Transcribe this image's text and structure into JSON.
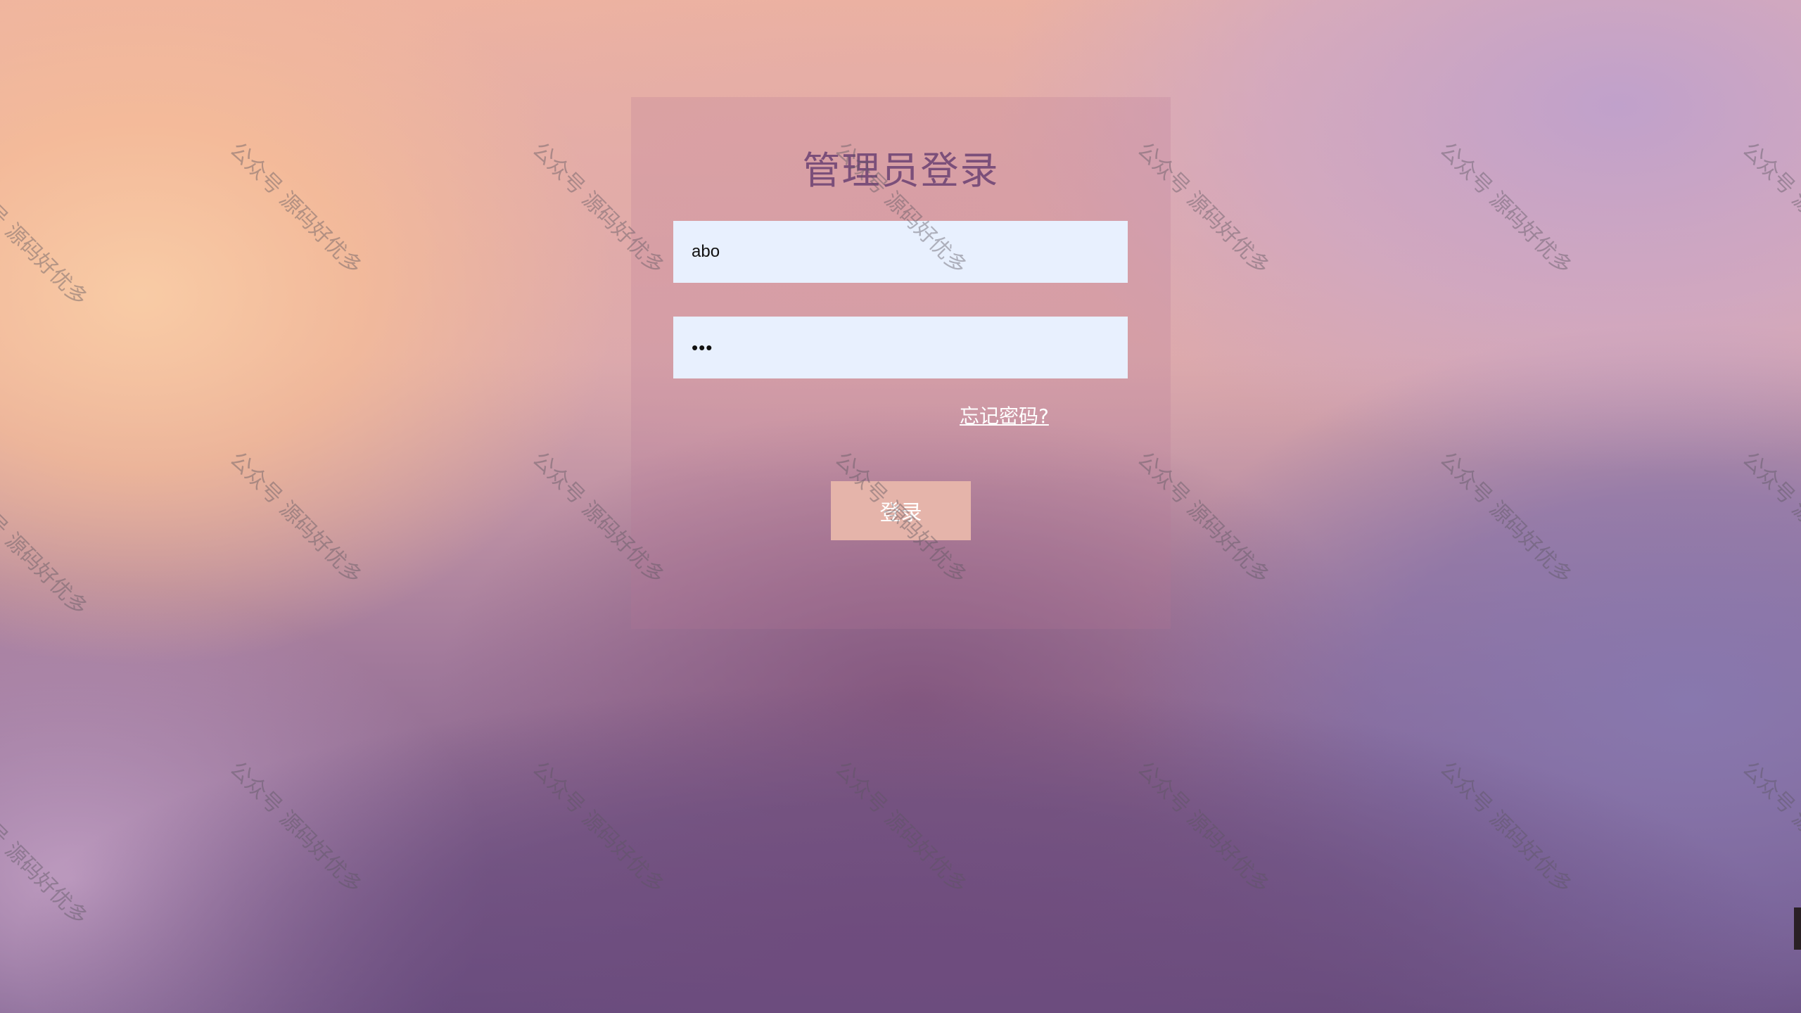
{
  "login_panel": {
    "title": "管理员登录",
    "username_value": "abo",
    "password_masked_value": "•••",
    "forgot_password_link": "忘记密码?",
    "login_button_label": "登录"
  },
  "watermark": {
    "text": "公众号 源码好优多"
  },
  "colors": {
    "title": "#7b4f7a",
    "input_background": "#e8f0fe",
    "login_button": "#e5b4aa"
  }
}
